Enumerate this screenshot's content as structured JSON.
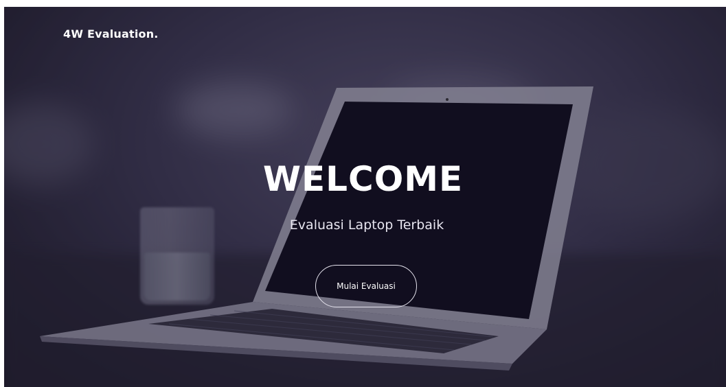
{
  "navbar": {
    "brand": "4W Evaluation."
  },
  "hero": {
    "title": "WELCOME",
    "subtitle": "Evaluasi Laptop Terbaik",
    "cta_label": "Mulai Evaluasi"
  },
  "colors": {
    "overlay": "#2a2438",
    "text": "#ffffff",
    "button_border": "#e6e4ee"
  }
}
